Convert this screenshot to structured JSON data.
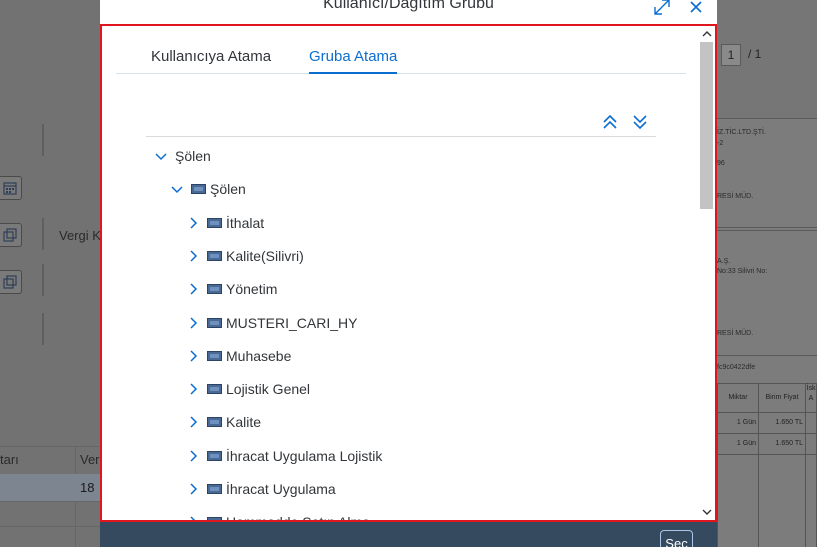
{
  "dialog": {
    "title": "Kullanıcı/Dağıtım Grubu",
    "tabs": [
      {
        "label": "Kullanıcıya Atama",
        "active": false
      },
      {
        "label": "Gruba Atama",
        "active": true
      }
    ],
    "footer": {
      "select_label": "Seç"
    },
    "accent_color": "#0a6ed1",
    "highlight_border_color": "#e0161e"
  },
  "tree": {
    "toolbar": {
      "collapse_all_icon": "double-chevron-up-icon",
      "expand_all_icon": "double-chevron-down-icon"
    },
    "nodes": [
      {
        "label": "Şölen",
        "level": 0,
        "expanded": true,
        "has_icon": false
      },
      {
        "label": "Şölen",
        "level": 1,
        "expanded": true,
        "has_icon": true
      },
      {
        "label": "İthalat",
        "level": 2,
        "expanded": false,
        "has_icon": true
      },
      {
        "label": "Kalite(Silivri)",
        "level": 2,
        "expanded": false,
        "has_icon": true
      },
      {
        "label": "Yönetim",
        "level": 2,
        "expanded": false,
        "has_icon": true
      },
      {
        "label": "MUSTERI_CARI_HY",
        "level": 2,
        "expanded": false,
        "has_icon": true
      },
      {
        "label": "Muhasebe",
        "level": 2,
        "expanded": false,
        "has_icon": true
      },
      {
        "label": "Lojistik Genel",
        "level": 2,
        "expanded": false,
        "has_icon": true
      },
      {
        "label": "Kalite",
        "level": 2,
        "expanded": false,
        "has_icon": true
      },
      {
        "label": "İhracat Uygulama Lojistik",
        "level": 2,
        "expanded": false,
        "has_icon": true
      },
      {
        "label": "İhracat Uygulama",
        "level": 2,
        "expanded": false,
        "has_icon": true
      },
      {
        "label": "Hammadde Satın Alma",
        "level": 2,
        "expanded": false,
        "has_icon": true
      }
    ]
  },
  "background": {
    "left": {
      "field_label": "Vergi K",
      "table_header_1": "tarı",
      "table_header_2": "Ver",
      "row_value": "18"
    },
    "right": {
      "pager_current": "1",
      "pager_total": "/ 1",
      "doc_lines": [
        "İZ.TİC.LTD.ŞTİ.",
        "-2",
        "96",
        "RESİ MÜD.",
        "A.Ş.",
        "No:33 Silivri  No:",
        "RESİ MÜD.",
        "fc9c0422dfe"
      ],
      "table_headers": [
        "Miktar",
        "Birim Fiyat",
        "İsk A"
      ],
      "table_rows": [
        [
          "1 Gün",
          "1.650 TL"
        ],
        [
          "1 Gün",
          "1.650 TL"
        ]
      ]
    }
  }
}
